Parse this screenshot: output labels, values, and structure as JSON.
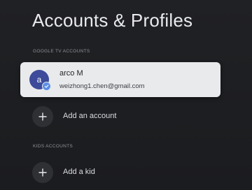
{
  "header": {
    "title": "Accounts & Profiles"
  },
  "google_tv_accounts": {
    "section_label": "GOOGLE TV ACCOUNTS",
    "accounts": [
      {
        "avatar_letter": "a",
        "name": "arco M",
        "email": "weizhong1.chen@gmail.com",
        "avatar_color": "#3d4b9a",
        "badge_icon": "check-icon"
      }
    ],
    "add_account_label": "Add an account",
    "add_account_icon": "plus-icon"
  },
  "kids_accounts": {
    "section_label": "KIDS ACCOUNTS",
    "add_kid_label": "Add a kid",
    "add_kid_icon": "plus-icon"
  },
  "colors": {
    "background": "#1e1f22",
    "card_background": "#e9eaec",
    "accent": "#5b8ee6"
  }
}
